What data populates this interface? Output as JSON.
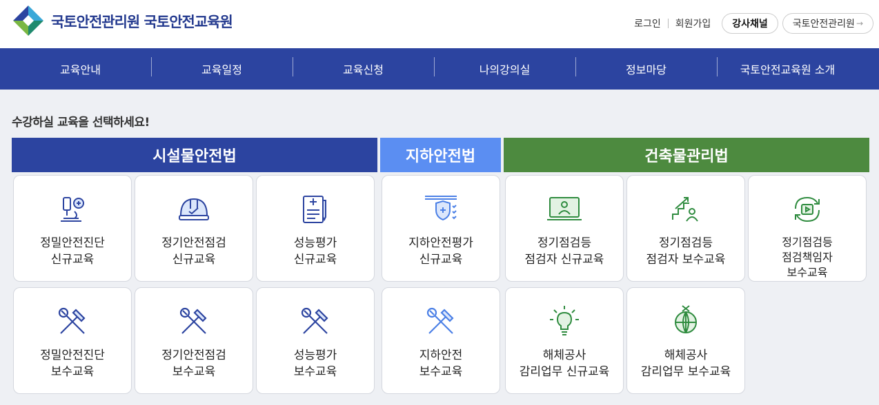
{
  "header": {
    "brand_title": "국토안전관리원 국토안전교육원",
    "utility_links": [
      "로그인",
      "회원가입"
    ],
    "instructor_channel": "강사채널",
    "kalis_link": "국토안전관리원",
    "kalis_arrow": "→"
  },
  "nav": {
    "items": [
      "교육안내",
      "교육일정",
      "교육신청",
      "나의강의실",
      "정보마당",
      "국토안전교육원 소개"
    ]
  },
  "main": {
    "prompt": "수강하실 교육을 선택하세요!",
    "categories": [
      "시설물안전법",
      "지하안전법",
      "건축물관리법"
    ],
    "category_colors": {
      "facility": "#2c44a0",
      "underground": "#5b8ef2",
      "building": "#4d8a3f"
    },
    "cards": [
      {
        "lines": [
          "정밀안전진단",
          "신규교육"
        ],
        "icon": "microscope-icon"
      },
      {
        "lines": [
          "정기안전점검",
          "신규교육"
        ],
        "icon": "hardhat-icon"
      },
      {
        "lines": [
          "성능평가",
          "신규교육"
        ],
        "icon": "clipboard-pen-icon"
      },
      {
        "lines": [
          "지하안전평가",
          "신규교육"
        ],
        "icon": "shield-check-icon"
      },
      {
        "lines": [
          "정기점검등",
          "점검자 신규교육"
        ],
        "icon": "monitor-person-icon"
      },
      {
        "lines": [
          "정기점검등",
          "점검자 보수교육"
        ],
        "icon": "stairs-person-icon"
      },
      {
        "lines": [
          "정기점검등",
          "점검책임자",
          "보수교육"
        ],
        "icon": "refresh-play-icon"
      },
      {
        "lines": [
          "정밀안전진단",
          "보수교육"
        ],
        "icon": "tools-icon"
      },
      {
        "lines": [
          "정기안전점검",
          "보수교육"
        ],
        "icon": "tools-icon"
      },
      {
        "lines": [
          "성능평가",
          "보수교육"
        ],
        "icon": "tools-icon"
      },
      {
        "lines": [
          "지하안전",
          "보수교육"
        ],
        "icon": "tools-icon"
      },
      {
        "lines": [
          "해체공사",
          "감리업무 신규교육"
        ],
        "icon": "lightbulb-icon"
      },
      {
        "lines": [
          "해체공사",
          "감리업무 보수교육"
        ],
        "icon": "globe-tools-icon"
      }
    ]
  }
}
